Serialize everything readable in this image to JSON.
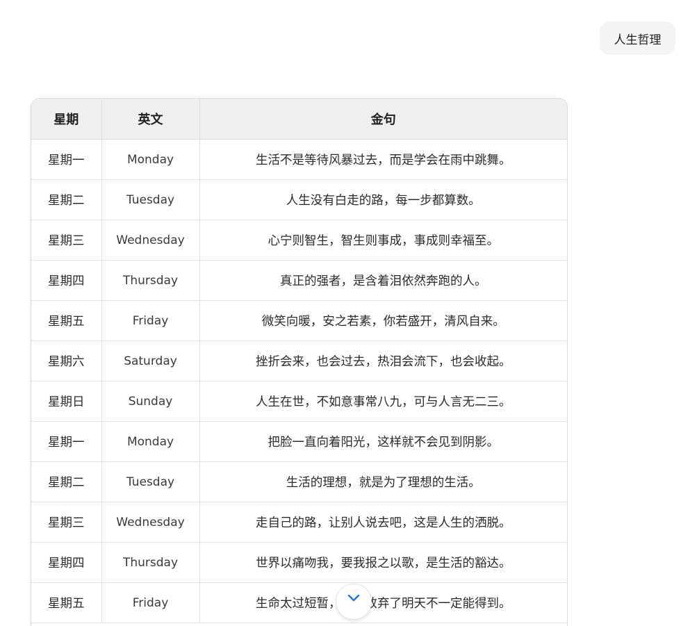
{
  "user_message": "人生哲理",
  "table": {
    "headers": [
      "星期",
      "英文",
      "金句"
    ],
    "rows": [
      [
        "星期一",
        "Monday",
        "生活不是等待风暴过去，而是学会在雨中跳舞。"
      ],
      [
        "星期二",
        "Tuesday",
        "人生没有白走的路，每一步都算数。"
      ],
      [
        "星期三",
        "Wednesday",
        "心宁则智生，智生则事成，事成则幸福至。"
      ],
      [
        "星期四",
        "Thursday",
        "真正的强者，是含着泪依然奔跑的人。"
      ],
      [
        "星期五",
        "Friday",
        "微笑向暖，安之若素，你若盛开，清风自来。"
      ],
      [
        "星期六",
        "Saturday",
        "挫折会来，也会过去，热泪会流下，也会收起。"
      ],
      [
        "星期日",
        "Sunday",
        "人生在世，不如意事常八九，可与人言无二三。"
      ],
      [
        "星期一",
        "Monday",
        "把脸一直向着阳光，这样就不会见到阴影。"
      ],
      [
        "星期二",
        "Tuesday",
        "生活的理想，就是为了理想的生活。"
      ],
      [
        "星期三",
        "Wednesday",
        "走自己的路，让别人说去吧，这是人生的洒脱。"
      ],
      [
        "星期四",
        "Thursday",
        "世界以痛吻我，要我报之以歌，是生活的豁达。"
      ],
      [
        "星期五",
        "Friday",
        "生命太过短暂，今天放弃了明天不一定能得到。"
      ]
    ]
  },
  "scroll_button": {
    "icon": "chevron-down-icon",
    "color": "#1a73e8"
  }
}
